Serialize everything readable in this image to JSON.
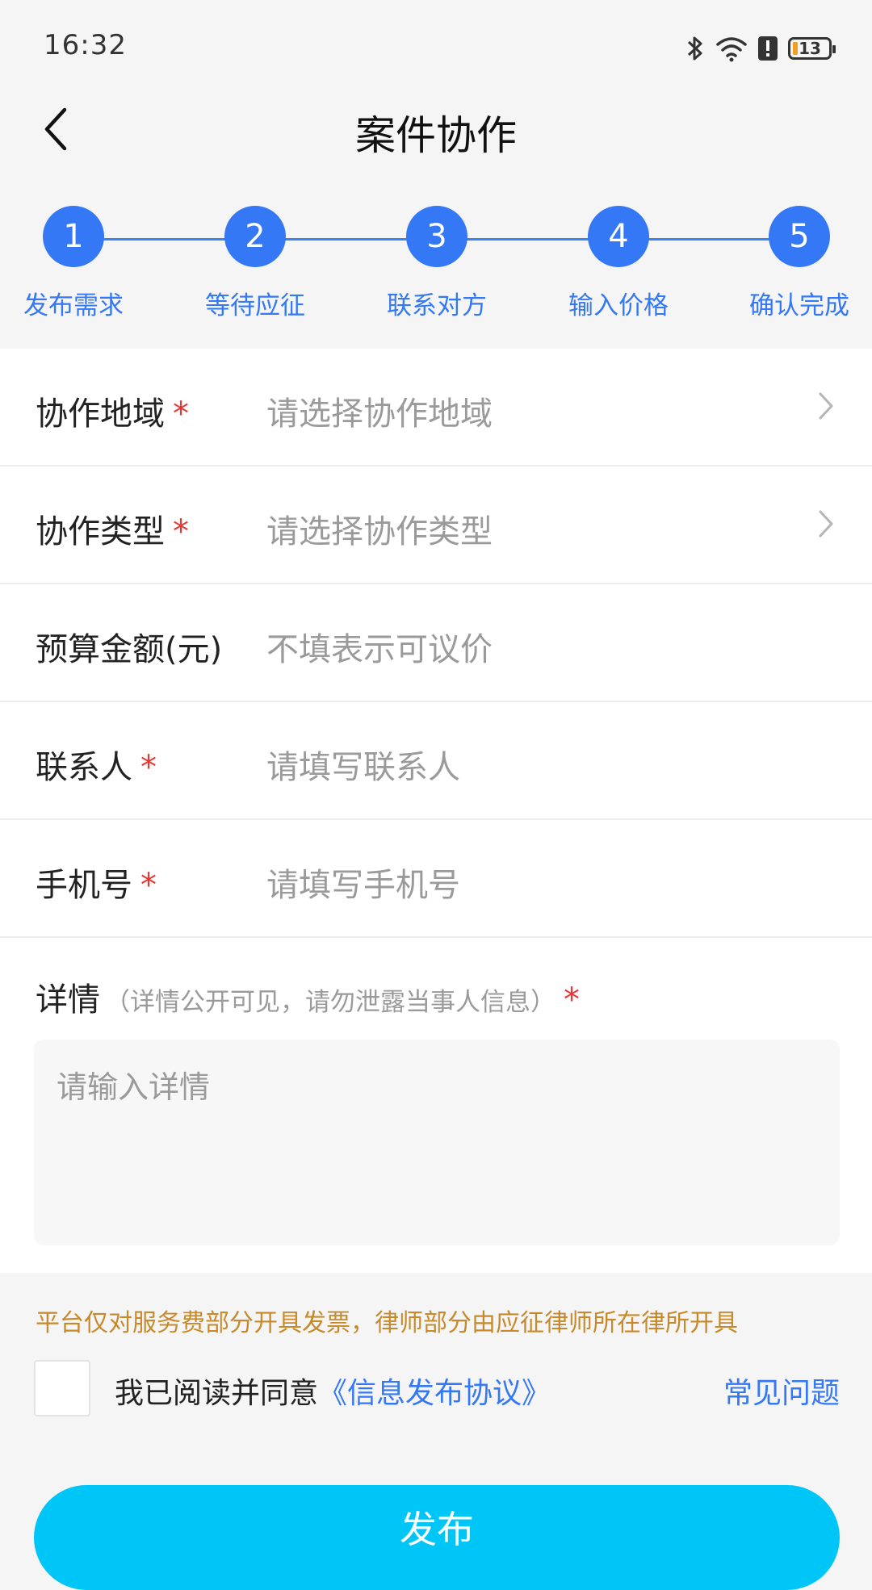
{
  "status_bar": {
    "time": "16:32",
    "battery_level": "13",
    "icons": [
      "bluetooth-icon",
      "wifi-icon",
      "alert-icon",
      "battery-icon"
    ]
  },
  "header": {
    "title": "案件协作",
    "back_icon": "chevron-left-icon"
  },
  "steps": [
    {
      "number": "1",
      "label": "发布需求"
    },
    {
      "number": "2",
      "label": "等待应征"
    },
    {
      "number": "3",
      "label": "联系对方"
    },
    {
      "number": "4",
      "label": "输入价格"
    },
    {
      "number": "5",
      "label": "确认完成"
    }
  ],
  "form": {
    "rows": [
      {
        "label": "协作地域",
        "required": "*",
        "placeholder": "请选择协作地域",
        "chevron": true
      },
      {
        "label": "协作类型",
        "required": "*",
        "placeholder": "请选择协作类型",
        "chevron": true
      },
      {
        "label": "预算金额(元)",
        "required": "",
        "placeholder": "不填表示可议价",
        "chevron": false
      },
      {
        "label": "联系人",
        "required": "*",
        "placeholder": "请填写联系人",
        "chevron": false
      },
      {
        "label": "手机号",
        "required": "*",
        "placeholder": "请填写手机号",
        "chevron": false
      }
    ],
    "details": {
      "label": "详情",
      "hint": "（详情公开可见，请勿泄露当事人信息）",
      "required": "*",
      "placeholder": "请输入详情"
    }
  },
  "notice": "平台仅对服务费部分开具发票，律师部分由应征律师所在律所开具",
  "agreement": {
    "text": "我已阅读并同意",
    "link": "《信息发布协议》",
    "faq": "常见问题",
    "checked": false
  },
  "publish_button": "发布",
  "colors": {
    "accent": "#3478f6",
    "button": "#00c6f8",
    "required": "#e53935",
    "notice": "#c8892a"
  }
}
